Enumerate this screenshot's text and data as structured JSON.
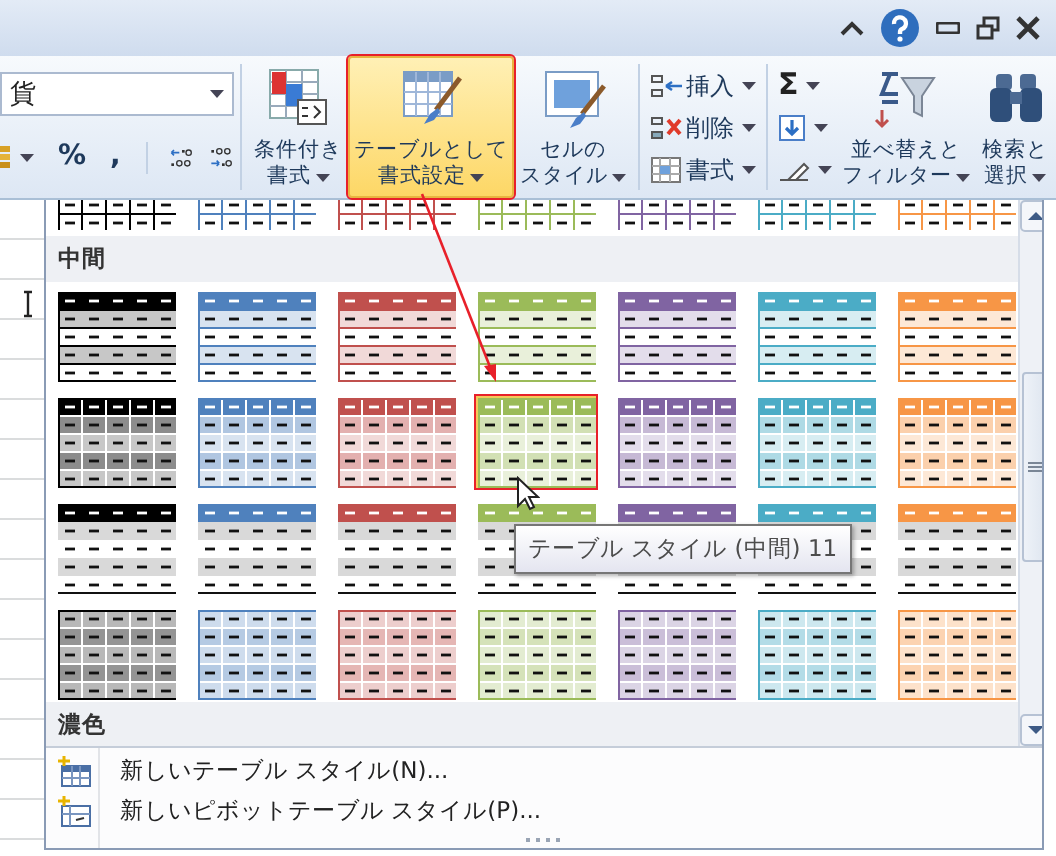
{
  "ribbon": {
    "number_format": {
      "value": "貨"
    },
    "number_buttons": [
      {
        "label": "%"
      },
      {
        "label": ","
      }
    ],
    "large_buttons": [
      {
        "lines": [
          "条件付き",
          "書式"
        ],
        "active": false,
        "highlighted": false
      },
      {
        "lines": [
          "テーブルとして",
          "書式設定"
        ],
        "active": true,
        "highlighted": true
      },
      {
        "lines": [
          "セルの",
          "スタイル"
        ],
        "active": false,
        "highlighted": false
      }
    ],
    "cells_buttons": [
      {
        "label": "挿入"
      },
      {
        "label": "削除"
      },
      {
        "label": "書式"
      }
    ],
    "sum_button": {
      "label": "Σ"
    },
    "editing_buttons": [
      {
        "lines": [
          "並べ替えと",
          "フィルター"
        ]
      },
      {
        "lines": [
          "検索と",
          "選択"
        ]
      }
    ]
  },
  "gallery": {
    "partial_row": {
      "kind": "light",
      "items": [
        {
          "color": "#000000",
          "selected": false
        },
        {
          "color": "#4f81bd",
          "selected": false
        },
        {
          "color": "#c0504d",
          "selected": false
        },
        {
          "color": "#9bbb59",
          "selected": false
        },
        {
          "color": "#8064a2",
          "selected": false
        },
        {
          "color": "#4bacc6",
          "selected": false
        },
        {
          "color": "#f79646",
          "selected": false
        }
      ]
    },
    "sections": [
      {
        "title": "中間",
        "rows": [
          {
            "kind": "banded",
            "items": [
              {
                "color": "#000000",
                "selected": false
              },
              {
                "color": "#4f81bd",
                "selected": false
              },
              {
                "color": "#c0504d",
                "selected": false
              },
              {
                "color": "#9bbb59",
                "selected": false
              },
              {
                "color": "#8064a2",
                "selected": false
              },
              {
                "color": "#4bacc6",
                "selected": false
              },
              {
                "color": "#f79646",
                "selected": false
              }
            ]
          },
          {
            "kind": "grid",
            "items": [
              {
                "color": "#000000",
                "selected": false
              },
              {
                "color": "#4f81bd",
                "selected": false
              },
              {
                "color": "#c0504d",
                "selected": false
              },
              {
                "color": "#9bbb59",
                "selected": true
              },
              {
                "color": "#8064a2",
                "selected": false
              },
              {
                "color": "#4bacc6",
                "selected": false
              },
              {
                "color": "#f79646",
                "selected": false
              }
            ]
          },
          {
            "kind": "grayband",
            "items": [
              {
                "color": "#000000",
                "selected": false
              },
              {
                "color": "#4f81bd",
                "selected": false
              },
              {
                "color": "#c0504d",
                "selected": false
              },
              {
                "color": "#9bbb59",
                "selected": false
              },
              {
                "color": "#8064a2",
                "selected": false
              },
              {
                "color": "#4bacc6",
                "selected": false
              },
              {
                "color": "#f79646",
                "selected": false
              }
            ]
          },
          {
            "kind": "tinted",
            "items": [
              {
                "color": "#000000",
                "selected": false
              },
              {
                "color": "#4f81bd",
                "selected": false
              },
              {
                "color": "#c0504d",
                "selected": false
              },
              {
                "color": "#9bbb59",
                "selected": false
              },
              {
                "color": "#8064a2",
                "selected": false
              },
              {
                "color": "#4bacc6",
                "selected": false
              },
              {
                "color": "#f79646",
                "selected": false
              }
            ]
          }
        ]
      },
      {
        "title": "濃色"
      }
    ],
    "menu_items": [
      {
        "label": "新しいテーブル スタイル(N)..."
      },
      {
        "label": "新しいピボットテーブル スタイル(P)..."
      }
    ]
  },
  "tooltip": "テーブル スタイル (中間) 11",
  "callout_arrow": true
}
